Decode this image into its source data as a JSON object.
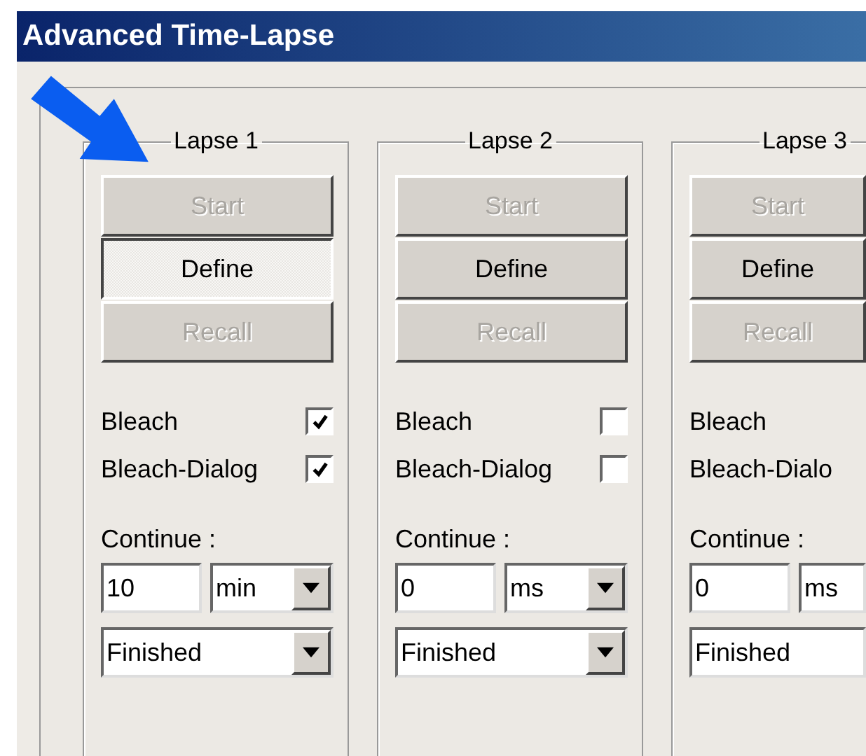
{
  "window": {
    "title": "Advanced Time-Lapse"
  },
  "lapses": [
    {
      "title": "Lapse 1",
      "buttons": [
        {
          "label": "Start",
          "disabled": true,
          "selected": false
        },
        {
          "label": "Define",
          "disabled": false,
          "selected": true
        },
        {
          "label": "Recall",
          "disabled": true,
          "selected": false
        }
      ],
      "checks": [
        {
          "label": "Bleach",
          "checked": true
        },
        {
          "label": "Bleach-Dialog",
          "checked": true
        }
      ],
      "continue_label": "Continue :",
      "value": "10",
      "unit": "min",
      "status": "Finished"
    },
    {
      "title": "Lapse 2",
      "buttons": [
        {
          "label": "Start",
          "disabled": true,
          "selected": false
        },
        {
          "label": "Define",
          "disabled": false,
          "selected": false
        },
        {
          "label": "Recall",
          "disabled": true,
          "selected": false
        }
      ],
      "checks": [
        {
          "label": "Bleach",
          "checked": false
        },
        {
          "label": "Bleach-Dialog",
          "checked": false
        }
      ],
      "continue_label": "Continue :",
      "value": "0",
      "unit": "ms",
      "status": "Finished"
    },
    {
      "title": "Lapse 3",
      "cut": true,
      "buttons": [
        {
          "label": "Start",
          "disabled": true,
          "selected": false
        },
        {
          "label": "Define",
          "disabled": false,
          "selected": false
        },
        {
          "label": "Recall",
          "disabled": true,
          "selected": false
        }
      ],
      "checks": [
        {
          "label": "Bleach"
        },
        {
          "label": "Bleach-Dialo"
        }
      ],
      "continue_label": "Continue :",
      "value": "0",
      "unit": "ms",
      "status": "Finished"
    }
  ]
}
